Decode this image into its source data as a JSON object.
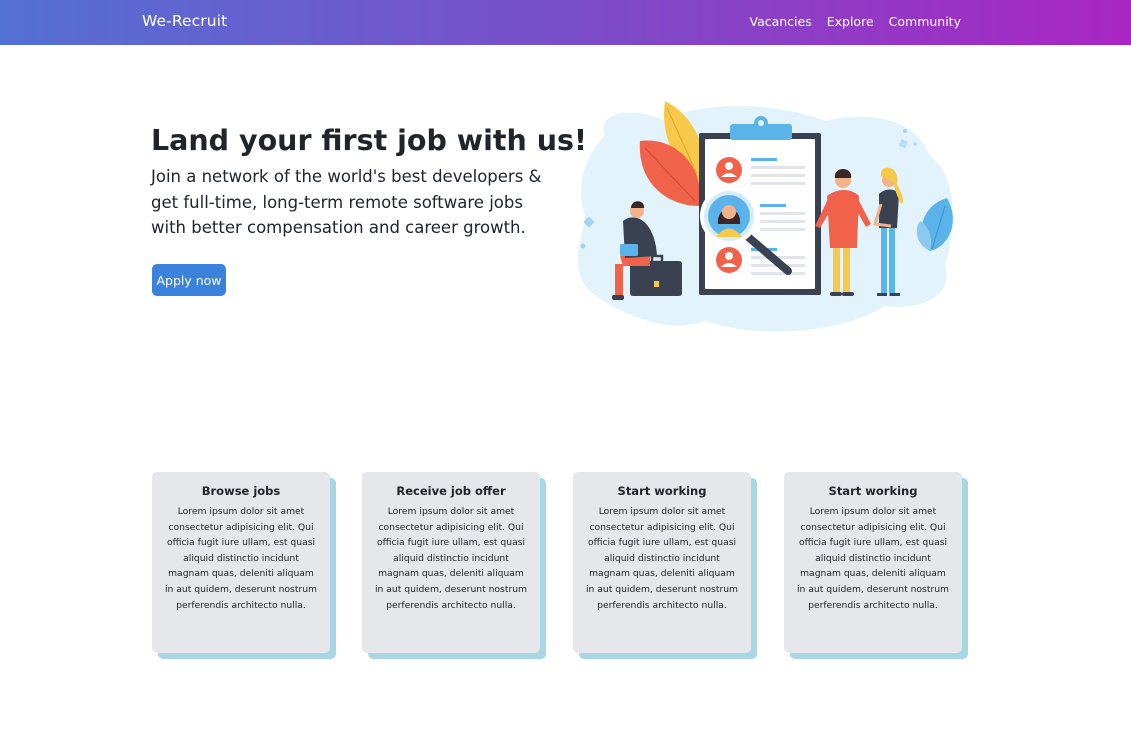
{
  "theme": {
    "nav_gradient_start": "#5470d4",
    "nav_gradient_end": "#a926c3",
    "button_color": "#3b82dc",
    "card_bg": "#e6e7eb",
    "card_shadow": "#a9d6e5"
  },
  "navbar": {
    "brand": "We-Recruit",
    "links": [
      "Vacancies",
      "Explore",
      "Community"
    ]
  },
  "hero": {
    "title": "Land your first job with us!",
    "subtitle": "Join a network of the world's best developers & get full-time, long-term remote software jobs with better compensation and career growth.",
    "button_label": "Apply now",
    "illustration": "recruitment-clipboard-illustration"
  },
  "cards": [
    {
      "title": "Browse jobs",
      "text": "Lorem ipsum dolor sit amet consectetur adipisicing elit. Qui officia fugit iure ullam, est quasi aliquid distinctio incidunt magnam quas, deleniti aliquam in aut quidem, deserunt nostrum perferendis architecto nulla."
    },
    {
      "title": "Receive job offer",
      "text": "Lorem ipsum dolor sit amet consectetur adipisicing elit. Qui officia fugit iure ullam, est quasi aliquid distinctio incidunt magnam quas, deleniti aliquam in aut quidem, deserunt nostrum perferendis architecto nulla."
    },
    {
      "title": "Start working",
      "text": "Lorem ipsum dolor sit amet consectetur adipisicing elit. Qui officia fugit iure ullam, est quasi aliquid distinctio incidunt magnam quas, deleniti aliquam in aut quidem, deserunt nostrum perferendis architecto nulla."
    },
    {
      "title": "Start working",
      "text": "Lorem ipsum dolor sit amet consectetur adipisicing elit. Qui officia fugit iure ullam, est quasi aliquid distinctio incidunt magnam quas, deleniti aliquam in aut quidem, deserunt nostrum perferendis architecto nulla."
    }
  ]
}
